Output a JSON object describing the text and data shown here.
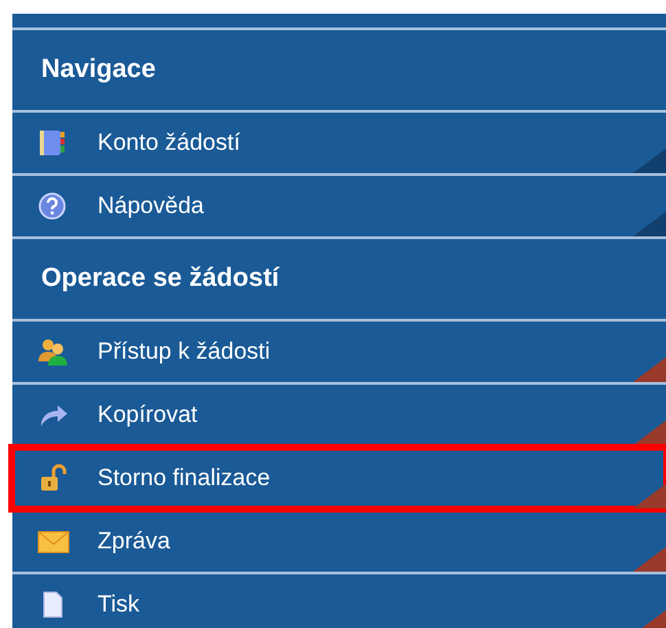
{
  "sections": [
    {
      "title": "Navigace",
      "color": "#12406e",
      "items": [
        {
          "label": "Konto žádostí",
          "highlighted": false
        },
        {
          "label": "Nápověda",
          "highlighted": false
        }
      ]
    },
    {
      "title": "Operace se žádostí",
      "color": "#9a3a2a",
      "items": [
        {
          "label": "Přístup k žádosti",
          "highlighted": false
        },
        {
          "label": "Kopírovat",
          "highlighted": false
        },
        {
          "label": "Storno finalizace",
          "highlighted": true
        },
        {
          "label": "Zpráva",
          "highlighted": false
        },
        {
          "label": "Tisk",
          "highlighted": false
        }
      ]
    }
  ]
}
